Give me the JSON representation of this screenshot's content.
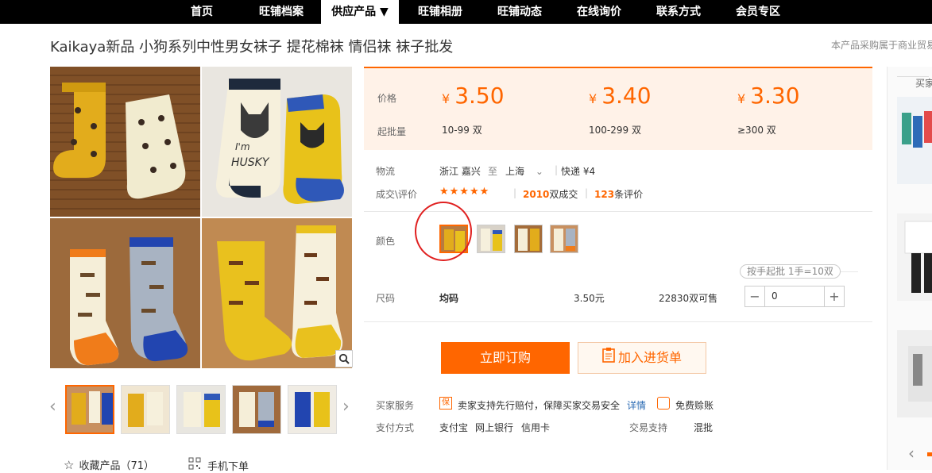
{
  "nav": {
    "items": [
      "首页",
      "旺铺档案",
      "供应产品 ▼",
      "旺铺相册",
      "旺铺动态",
      "在线询价",
      "联系方式",
      "会员专区"
    ],
    "active": 2
  },
  "product": {
    "title": "Kaikaya新品 小狗系列中性男女袜子 提花棉袜 情侣袜 袜子批发",
    "top_right_note": "本产品采购属于商业贸易"
  },
  "price": {
    "price_label": "价格",
    "minq_label": "起批量",
    "currency": "¥",
    "tiers": [
      {
        "price": "3.50",
        "qty": "10-99",
        "unit": "双"
      },
      {
        "price": "3.40",
        "qty": "100-299",
        "unit": "双"
      },
      {
        "price": "3.30",
        "qty": "≥300",
        "unit": "双"
      }
    ]
  },
  "logistics": {
    "label": "物流",
    "from": "浙江 嘉兴",
    "to_word": "至",
    "to": "上海",
    "express": "快递 ¥4"
  },
  "deals": {
    "label": "成交\\评价",
    "stars": "★★★★★",
    "count": "2010",
    "count_unit": "双成交",
    "reviews": "123",
    "reviews_unit": "条评价"
  },
  "color": {
    "label": "颜色"
  },
  "batch_tag": "按手起批 1手=10双",
  "size": {
    "label": "尺码",
    "value": "均码",
    "price": "3.50元",
    "stock": "22830双可售",
    "minus": "−",
    "plus": "+",
    "qty": "0"
  },
  "buttons": {
    "buy": "立即订购",
    "cart": "加入进货单"
  },
  "service": {
    "label": "买家服务",
    "badge": "保",
    "text": "卖家支持先行赔付，保障买家交易安全",
    "detail": "详情",
    "free": "免费赊账"
  },
  "payment": {
    "label": "支付方式",
    "methods": [
      "支付宝",
      "网上银行",
      "信用卡"
    ],
    "trade_label": "交易支持",
    "trade_value": "混批"
  },
  "footer": {
    "fav": "收藏产品（71）",
    "mobile": "手机下单"
  },
  "right": {
    "title": "买家"
  },
  "colors": {
    "accent": "#ff6600",
    "nav_bg": "#000000",
    "price_bg": "#fff2e8"
  }
}
